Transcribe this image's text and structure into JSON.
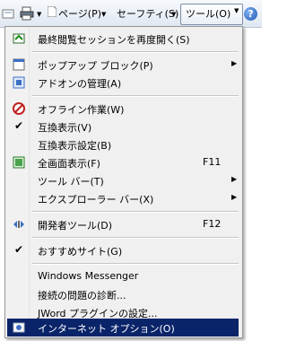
{
  "toolbar": {
    "page_label": "ページ(P)",
    "safety_label": "セーフティ(S)",
    "tools_label": "ツール(O)",
    "help_glyph": "?"
  },
  "menu": {
    "reopen_session": "最終閲覧セッションを再度開く(S)",
    "popup_blocker": "ポップアップ ブロック(P)",
    "manage_addons": "アドオンの管理(A)",
    "work_offline": "オフライン作業(W)",
    "compat_view": "互換表示(V)",
    "compat_settings": "互換表示設定(B)",
    "full_screen": "全画面表示(F)",
    "full_screen_key": "F11",
    "toolbars": "ツール バー(T)",
    "explorer_bars": "エクスプローラー バー(X)",
    "dev_tools": "開発者ツール(D)",
    "dev_tools_key": "F12",
    "suggested_sites": "おすすめサイト(G)",
    "messenger": "Windows Messenger",
    "diagnose": "接続の問題の診断...",
    "jword": "JWord プラグインの設定...",
    "internet_options": "インターネット オプション(O)"
  },
  "colors": {
    "highlight": "#0a246a",
    "menu_bg": "#f0f0f0"
  }
}
